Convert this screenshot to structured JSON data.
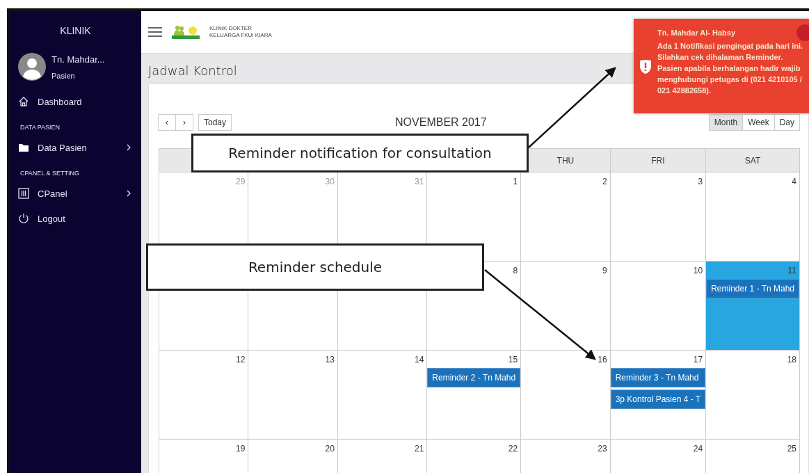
{
  "sidebar": {
    "title": "KLINIK",
    "user": {
      "name": "Tn. Mahdar...",
      "role": "Pasien"
    },
    "items": [
      {
        "kind": "link",
        "label": "Dashboard",
        "submenu": false
      },
      {
        "kind": "section",
        "label": "DATA PASIEN"
      },
      {
        "kind": "link",
        "label": "Data Pasien",
        "submenu": true
      },
      {
        "kind": "section",
        "label": "CPANEL & SETTING"
      },
      {
        "kind": "link",
        "label": "CPanel",
        "submenu": true
      },
      {
        "kind": "link",
        "label": "Logout",
        "submenu": false
      }
    ]
  },
  "topbar": {
    "logo_lines": [
      "KLINIK DOKTER",
      "KELUARGA FKUI KIARA"
    ]
  },
  "page_title": "Jadwal Kontrol",
  "calendar": {
    "nav_prev": "‹",
    "nav_next": "›",
    "today_button": "Today",
    "title": "NOVEMBER 2017",
    "views": [
      {
        "label": "Month",
        "selected": true
      },
      {
        "label": "Week",
        "selected": false
      },
      {
        "label": "Day",
        "selected": false
      }
    ],
    "day_headers": [
      "THU",
      "FRI",
      "SAT"
    ],
    "weeks": [
      [
        {
          "date": "29",
          "other_month": true
        },
        {
          "date": "30",
          "other_month": true
        },
        {
          "date": "31",
          "other_month": true
        },
        {
          "date": "1"
        },
        {
          "date": "2"
        },
        {
          "date": "3"
        },
        {
          "date": "4"
        }
      ],
      [
        {
          "date": "8"
        },
        {
          "date": "9"
        },
        {
          "date": "10"
        },
        {
          "date": "11",
          "today": true,
          "events": [
            "Reminder 1 - Tn Mahd"
          ]
        }
      ],
      [
        {
          "date": "12"
        },
        {
          "date": "13"
        },
        {
          "date": "14"
        },
        {
          "date": "15",
          "events": [
            "Reminder 2 - Tn Mahd"
          ]
        },
        {
          "date": "16"
        },
        {
          "date": "17",
          "events": [
            "Reminder 3 - Tn Mahd",
            "3p Kontrol Pasien 4 - T"
          ]
        },
        {
          "date": "18"
        }
      ],
      [
        {
          "date": "19"
        },
        {
          "date": "20"
        },
        {
          "date": "21"
        },
        {
          "date": "22"
        },
        {
          "date": "23"
        },
        {
          "date": "24"
        },
        {
          "date": "25"
        }
      ]
    ]
  },
  "notification": {
    "title": "Tn. Mahdar Al- Habsy",
    "message": "Ada 1 Notifikasi pengingat pada hari ini. Silahkan cek dihalaman Reminder. Pasien apabila berhalangan hadir wajib menghubungi petugas di (021 4210105 /  021 42882658)."
  },
  "callouts": [
    {
      "text": "Reminder notification for consultation"
    },
    {
      "text": "Reminder schedule"
    }
  ]
}
